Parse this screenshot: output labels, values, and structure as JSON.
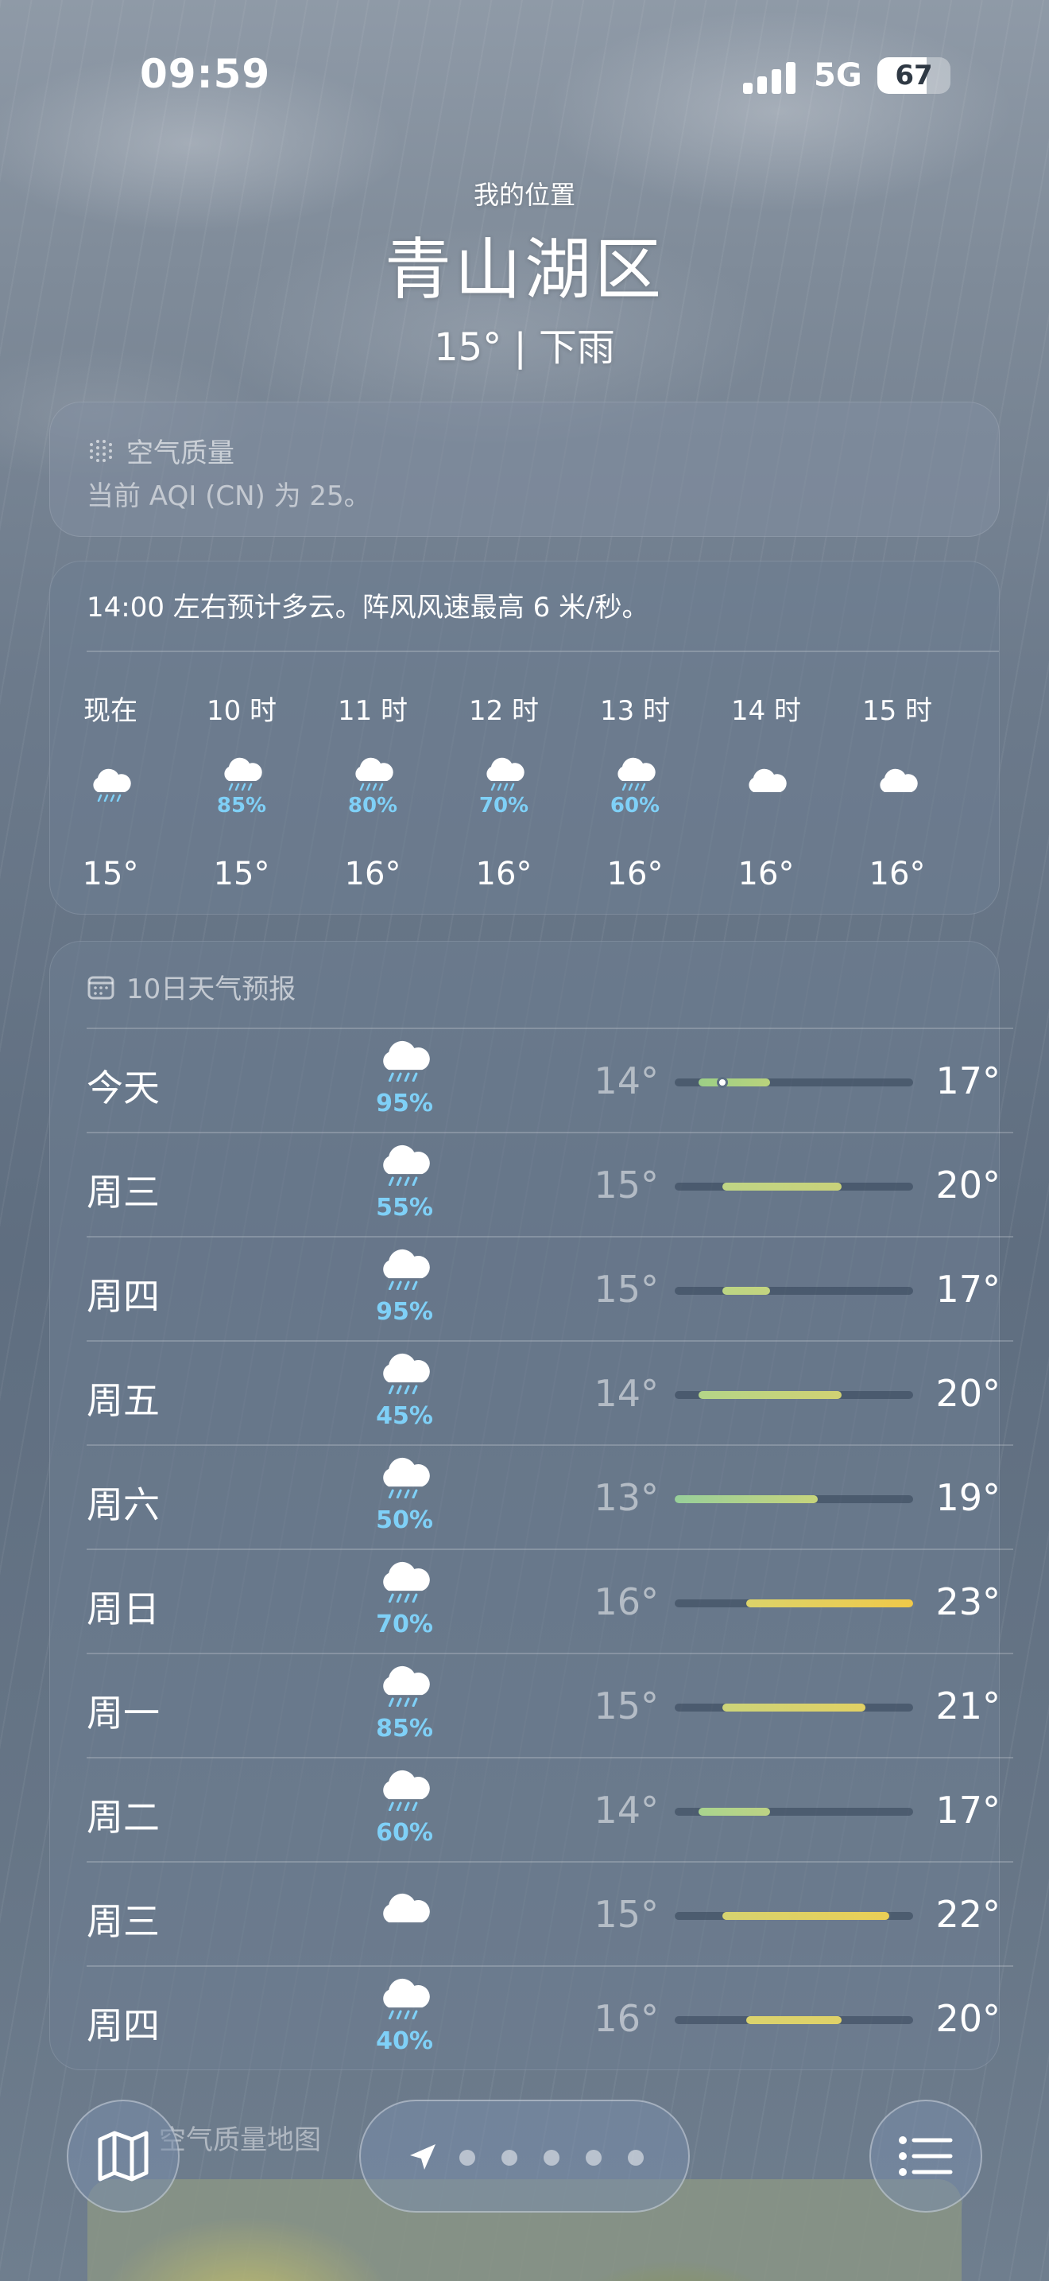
{
  "status_bar": {
    "time": "09:59",
    "network": "5G",
    "battery": "67",
    "battery_level": 0.67
  },
  "header": {
    "location_label": "我的位置",
    "city": "青山湖区",
    "condition": "15° | 下雨"
  },
  "air_quality": {
    "title": "空气质量",
    "text": "当前 AQI (CN) 为 25。",
    "icon": "aqi-dots-icon"
  },
  "hourly": {
    "summary": "14:00 左右预计多云。阵风风速最高 6 米/秒。",
    "items": [
      {
        "label": "现在",
        "icon": "rain-cloud-icon",
        "pct": "",
        "temp": "15°"
      },
      {
        "label": "10 时",
        "icon": "rain-cloud-icon",
        "pct": "85%",
        "temp": "15°"
      },
      {
        "label": "11 时",
        "icon": "rain-cloud-icon",
        "pct": "80%",
        "temp": "16°"
      },
      {
        "label": "12 时",
        "icon": "rain-cloud-icon",
        "pct": "70%",
        "temp": "16°"
      },
      {
        "label": "13 时",
        "icon": "rain-cloud-icon",
        "pct": "60%",
        "temp": "16°"
      },
      {
        "label": "14 时",
        "icon": "cloud-icon",
        "pct": "",
        "temp": "16°"
      },
      {
        "label": "15 时",
        "icon": "cloud-icon",
        "pct": "",
        "temp": "16°"
      }
    ]
  },
  "forecast": {
    "title": "10日天气预报",
    "icon": "calendar-icon",
    "scale_min": 13,
    "scale_max": 23,
    "days": [
      {
        "day": "今天",
        "icon": "rain-cloud-icon",
        "pct": "95%",
        "low": "14°",
        "high": "17°",
        "low_val": 14,
        "high_val": 17,
        "current_val": 15,
        "color_start": "#9ccf86",
        "color_end": "#b9d37c"
      },
      {
        "day": "周三",
        "icon": "rain-cloud-icon",
        "pct": "55%",
        "low": "15°",
        "high": "20°",
        "low_val": 15,
        "high_val": 20,
        "color_start": "#c0d585",
        "color_end": "#c9d27a"
      },
      {
        "day": "周四",
        "icon": "rain-cloud-icon",
        "pct": "95%",
        "low": "15°",
        "high": "17°",
        "low_val": 15,
        "high_val": 17,
        "color_start": "#bcd584",
        "color_end": "#c3d47f"
      },
      {
        "day": "周五",
        "icon": "rain-cloud-icon",
        "pct": "45%",
        "low": "14°",
        "high": "20°",
        "low_val": 14,
        "high_val": 20,
        "color_start": "#b4d488",
        "color_end": "#d1d273"
      },
      {
        "day": "周六",
        "icon": "rain-cloud-icon",
        "pct": "50%",
        "low": "13°",
        "high": "19°",
        "low_val": 13,
        "high_val": 19,
        "color_start": "#98cf9a",
        "color_end": "#c7d47c"
      },
      {
        "day": "周日",
        "icon": "rain-cloud-icon",
        "pct": "70%",
        "low": "16°",
        "high": "23°",
        "low_val": 16,
        "high_val": 23,
        "color_start": "#dcd36a",
        "color_end": "#f0c949"
      },
      {
        "day": "周一",
        "icon": "rain-cloud-icon",
        "pct": "85%",
        "low": "15°",
        "high": "21°",
        "low_val": 15,
        "high_val": 21,
        "color_start": "#cdd479",
        "color_end": "#e2d163"
      },
      {
        "day": "周二",
        "icon": "rain-cloud-icon",
        "pct": "60%",
        "low": "14°",
        "high": "17°",
        "low_val": 14,
        "high_val": 17,
        "color_start": "#a9d48e",
        "color_end": "#bdd384"
      },
      {
        "day": "周三",
        "icon": "cloud-icon",
        "pct": "",
        "low": "15°",
        "high": "22°",
        "low_val": 15,
        "high_val": 22,
        "color_start": "#d6d370",
        "color_end": "#ebcf55"
      },
      {
        "day": "周四",
        "icon": "rain-cloud-icon",
        "pct": "40%",
        "low": "16°",
        "high": "20°",
        "low_val": 16,
        "high_val": 20,
        "color_start": "#dbd36d",
        "color_end": "#dfd168"
      }
    ]
  },
  "map_card": {
    "title": "空气质量地图"
  },
  "toolbar": {
    "map_icon": "map-icon",
    "location_icon": "location-arrow-icon",
    "list_icon": "list-icon",
    "page_dots": 5
  }
}
